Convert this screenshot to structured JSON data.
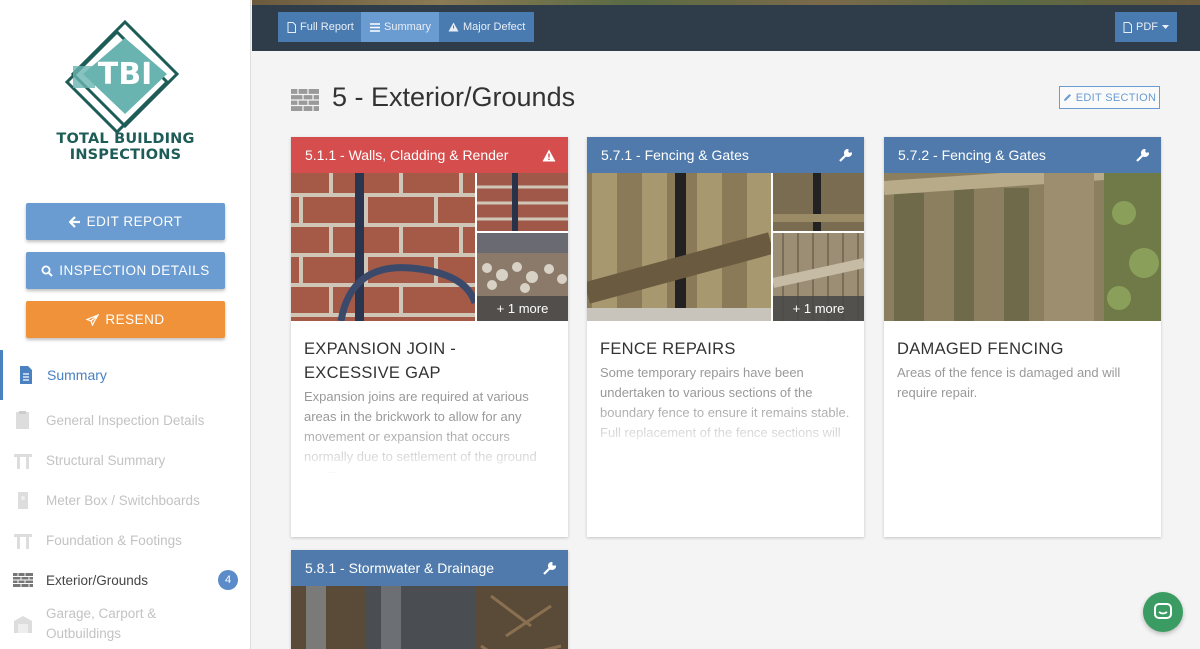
{
  "brand": {
    "logo_letters": "TBI",
    "name_line1": "TOTAL BUILDING",
    "name_line2": "INSPECTIONS",
    "logo_color": "#1d5c57",
    "accent": "#69b4b0"
  },
  "sidebar": {
    "buttons": [
      {
        "label": "EDIT REPORT",
        "icon": "arrow-left-icon",
        "color": "#6a9bd1"
      },
      {
        "label": "INSPECTION DETAILS",
        "icon": "search-icon",
        "color": "#6a9bd1"
      },
      {
        "label": "RESEND",
        "icon": "paper-plane-icon",
        "color": "#ef923a"
      }
    ],
    "nav": [
      {
        "label": "Summary",
        "icon": "document-icon",
        "state": "active"
      },
      {
        "label": "General Inspection Details",
        "icon": "clipboard-icon",
        "state": "disabled"
      },
      {
        "label": "Structural Summary",
        "icon": "frame-icon",
        "state": "disabled"
      },
      {
        "label": "Meter Box / Switchboards",
        "icon": "meter-box-icon",
        "state": "disabled"
      },
      {
        "label": "Foundation & Footings",
        "icon": "frame-icon",
        "state": "disabled"
      },
      {
        "label": "Exterior/Grounds",
        "icon": "brick-icon",
        "state": "current",
        "badge": "4"
      },
      {
        "label": "Garage, Carport & Outbuildings",
        "icon": "garage-icon",
        "state": "disabled"
      }
    ]
  },
  "toolbar": {
    "full_report": "Full Report",
    "summary": "Summary",
    "major_defect": "Major Defect",
    "pdf": "PDF"
  },
  "section": {
    "title": "5 - Exterior/Grounds",
    "edit_label": "EDIT SECTION"
  },
  "cards": [
    {
      "heading": "5.1.1 - Walls, Cladding & Render",
      "type": "major-defect",
      "color": "#d64d4d",
      "icon": "warning-icon",
      "more": "+ 1 more",
      "title": "EXPANSION JOIN - EXCESSIVE GAP",
      "body": "Expansion joins are required at various areas in the brickwork to allow for any movement or expansion that occurs normally due to settlement of the ground etc. The excessive gap may allow vermin to enter."
    },
    {
      "heading": "5.7.1 - Fencing & Gates",
      "type": "maintenance",
      "color": "#4f7aab",
      "icon": "wrench-icon",
      "more": "+ 1 more",
      "title": "FENCE REPAIRS",
      "body": "Some temporary repairs have been undertaken to various sections of the boundary fence to ensure it remains stable. Full replacement of the fence sections will be required in due course."
    },
    {
      "heading": "5.7.2 - Fencing & Gates",
      "type": "maintenance",
      "color": "#4f7aab",
      "icon": "wrench-icon",
      "title": "DAMAGED FENCING",
      "body": "Areas of the fence is damaged and will require repair."
    },
    {
      "heading": "5.8.1 - Stormwater & Drainage",
      "type": "maintenance",
      "color": "#4f7aab",
      "icon": "wrench-icon"
    }
  ]
}
